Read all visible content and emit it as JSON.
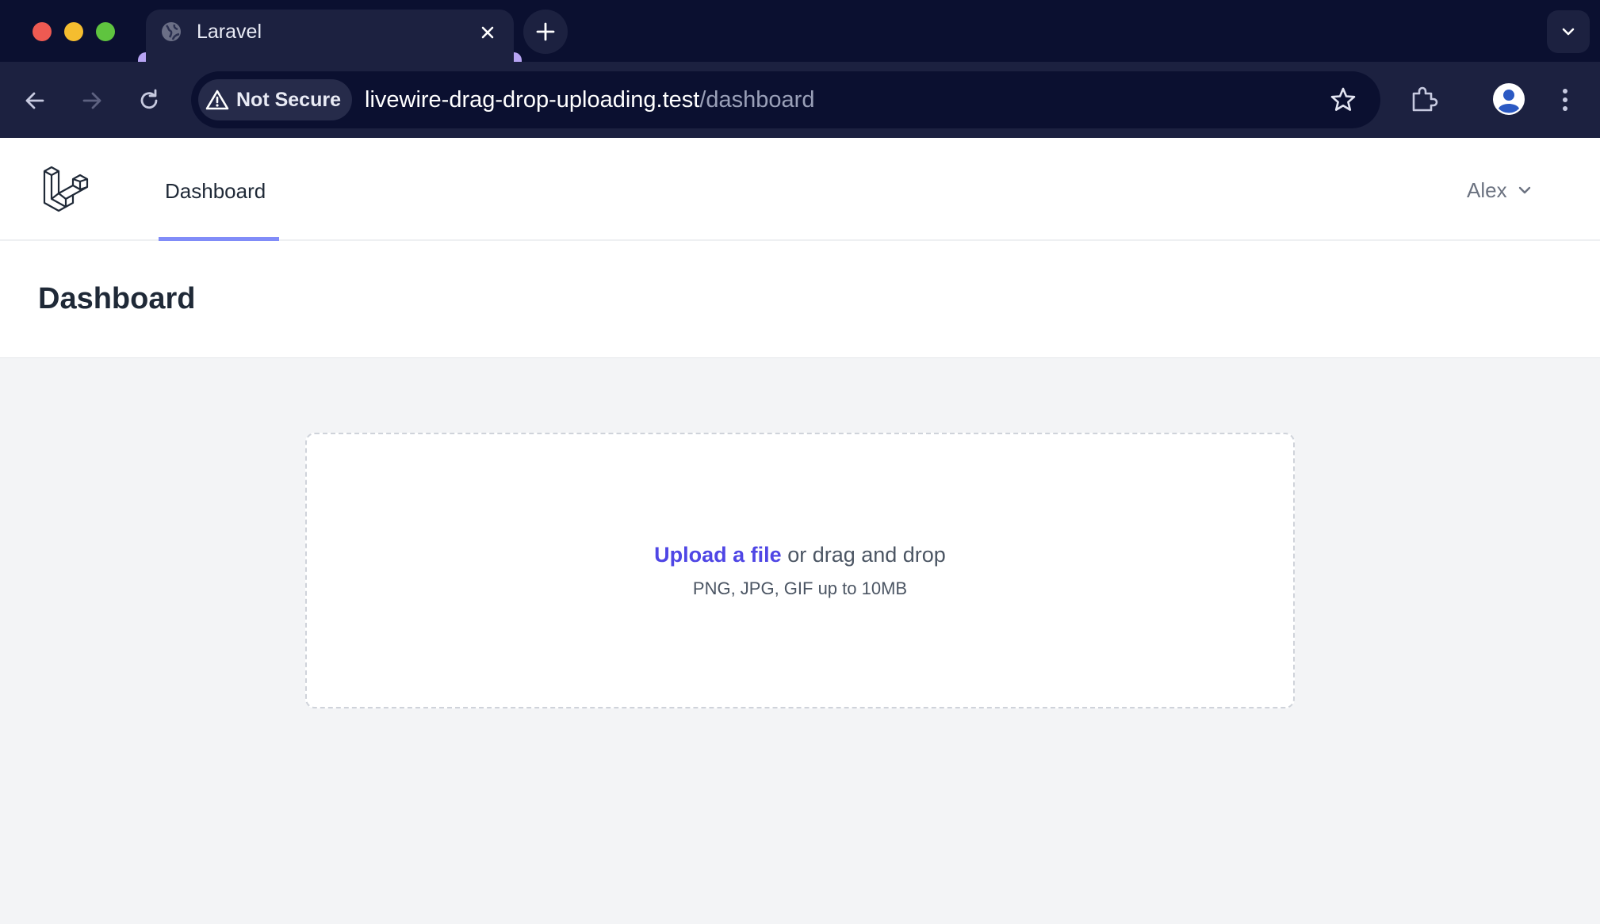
{
  "browser": {
    "tab": {
      "title": "Laravel"
    },
    "address": {
      "security_label": "Not Secure",
      "url_host": "livewire-drag-drop-uploading.test",
      "url_path": "/dashboard"
    },
    "colors": {
      "chrome_dark": "#0b1030",
      "chrome_mid": "#1c2140",
      "tab_accent": "#b7a4f3"
    }
  },
  "app": {
    "nav": {
      "logo": "laravel-logo",
      "links": [
        {
          "label": "Dashboard",
          "active": true
        }
      ],
      "user": {
        "name": "Alex"
      }
    },
    "header": {
      "title": "Dashboard"
    },
    "uploader": {
      "link_label": "Upload a file",
      "prompt_rest": " or drag and drop",
      "hint": "PNG, JPG, GIF up to 10MB"
    },
    "colors": {
      "accent": "#4f46e5",
      "nav_underline": "#818cf8",
      "background": "#f3f4f6"
    }
  }
}
